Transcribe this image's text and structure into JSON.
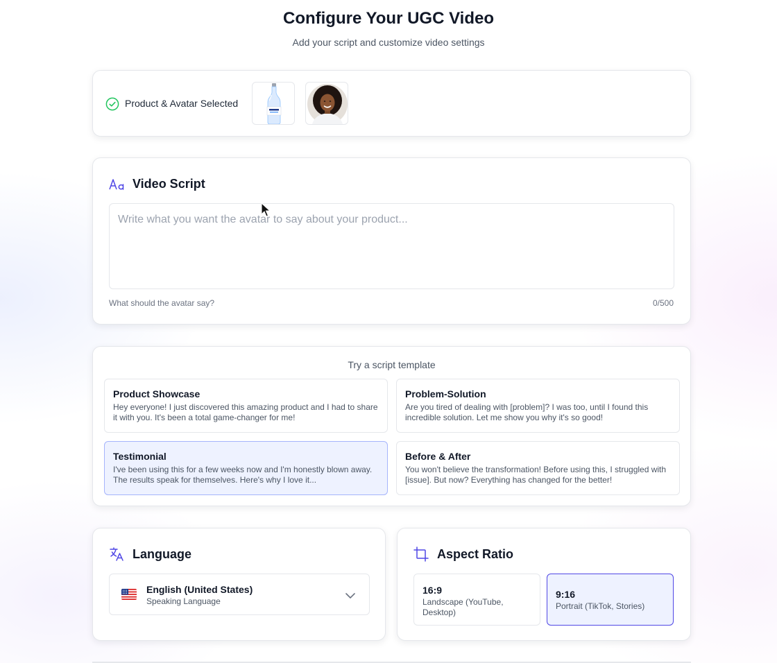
{
  "header": {
    "title": "Configure Your UGC Video",
    "subtitle": "Add your script and customize video settings"
  },
  "selection": {
    "label": "Product & Avatar Selected",
    "status_icon": "check-circle-icon",
    "thumbnails": [
      "product-bottle",
      "avatar-portrait"
    ]
  },
  "script": {
    "heading": "Video Script",
    "icon": "text-format-icon",
    "placeholder": "Write what you want the avatar to say about your product...",
    "value": "",
    "hint": "What should the avatar say?",
    "counter": "0/500"
  },
  "templates": {
    "title": "Try a script template",
    "items": [
      {
        "name": "Product Showcase",
        "body": "Hey everyone! I just discovered this amazing product and I had to share it with you. It's been a total game-changer for me!",
        "selected": false
      },
      {
        "name": "Problem-Solution",
        "body": "Are you tired of dealing with [problem]? I was too, until I found this incredible solution. Let me show you why it's so good!",
        "selected": false
      },
      {
        "name": "Testimonial",
        "body": "I've been using this for a few weeks now and I'm honestly blown away. The results speak for themselves. Here's why I love it...",
        "selected": true
      },
      {
        "name": "Before & After",
        "body": "You won't believe the transformation! Before using this, I struggled with [issue]. But now? Everything has changed for the better!",
        "selected": false
      }
    ]
  },
  "language": {
    "heading": "Language",
    "icon": "translate-icon",
    "selected": "English (United States)",
    "sub": "Speaking Language",
    "flag": "us-flag-icon"
  },
  "aspect": {
    "heading": "Aspect Ratio",
    "icon": "crop-icon",
    "options": [
      {
        "ratio": "16:9",
        "desc": "Landscape (YouTube, Desktop)",
        "selected": false
      },
      {
        "ratio": "9:16",
        "desc": "Portrait (TikTok, Stories)",
        "selected": true
      }
    ]
  },
  "colors": {
    "accent": "#4f46e5",
    "selected_bg": "#eef2ff",
    "success": "#22c55e",
    "text": "#111827",
    "muted": "#6b7280",
    "border": "#e5e7eb"
  }
}
